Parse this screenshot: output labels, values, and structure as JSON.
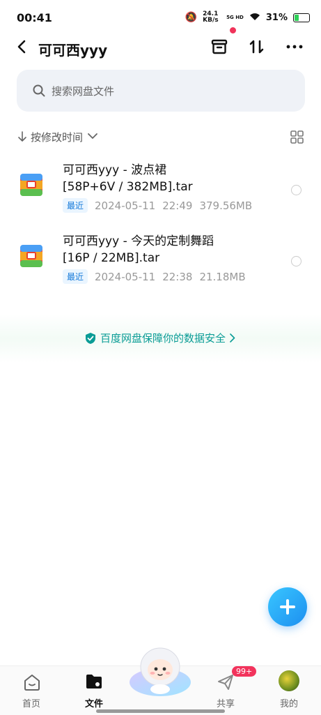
{
  "status": {
    "time": "00:41",
    "net_speed": "24.1 KB/s",
    "net_type": "5G HD",
    "battery": "31%",
    "battery_level": 0.31
  },
  "header": {
    "title": "可可西yyy"
  },
  "search": {
    "placeholder": "搜索网盘文件"
  },
  "sort": {
    "label": "按修改时间"
  },
  "files": [
    {
      "name_line1": "可可西yyy - 波点裙",
      "name_line2": "[58P+6V / 382MB].tar",
      "badge": "最近",
      "date": "2024-05-11",
      "time": "22:49",
      "size": "379.56MB"
    },
    {
      "name_line1": "可可西yyy - 今天的定制舞蹈",
      "name_line2": "[16P / 22MB].tar",
      "badge": "最近",
      "date": "2024-05-11",
      "time": "22:38",
      "size": "21.18MB"
    }
  ],
  "safety": {
    "text": "百度网盘保障你的数据安全"
  },
  "tabs": [
    {
      "label": "首页"
    },
    {
      "label": "文件"
    },
    {
      "label": "共享"
    },
    {
      "label": "我的"
    }
  ],
  "share_badge": "99+",
  "colors": {
    "accent": "#1d8ff0",
    "safe_text": "#0a9c96",
    "badge_red": "#f2335c"
  }
}
